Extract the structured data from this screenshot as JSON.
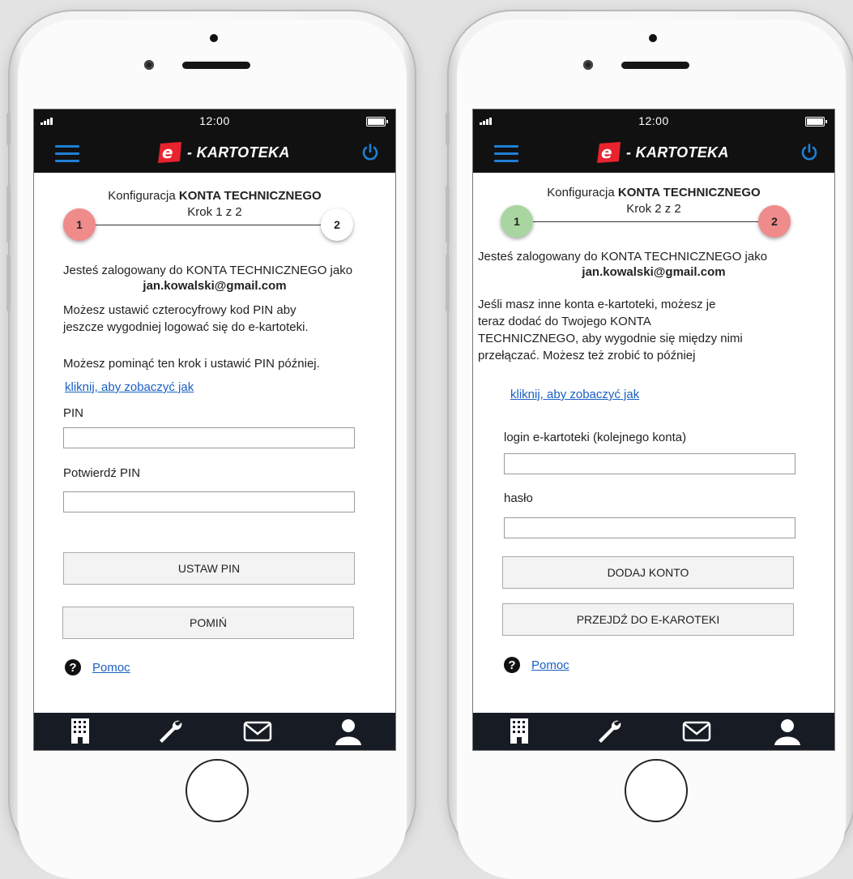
{
  "status_bar": {
    "time": "12:00"
  },
  "header": {
    "logo_text": "- KARTOTEKA",
    "logo_letter": "e"
  },
  "colors": {
    "accent": "#1e7fd6",
    "step_active": "#f08b8b",
    "step_done": "#a9d6a0",
    "link": "#1a5fc4",
    "nav_bg": "#161b24"
  },
  "icons": [
    "menu-icon",
    "power-icon",
    "building-icon",
    "wrench-icon",
    "mail-icon",
    "user-icon",
    "help-icon"
  ],
  "screen1": {
    "title_prefix": "Konfiguracja",
    "title_bold": "KONTA TECHNICZNEGO",
    "step": "Krok 1 z 2",
    "step1_label": "1",
    "step2_label": "2",
    "logged_in_text": "Jesteś zalogowany do KONTA TECHNICZNEGO  jako",
    "email": "jan.kowalski@gmail.com",
    "pin_info_line1": "Możesz ustawić czterocyfrowy kod PIN aby",
    "pin_info_line2": "jeszcze wygodniej logować się do e-kartoteki.",
    "skip_info": "Możesz pominąć ten krok i ustawić PIN później.",
    "link": "kliknij, aby zobaczyć jak",
    "pin_label": "PIN",
    "pin_value": "",
    "confirm_label": "Potwierdź PIN",
    "confirm_value": "",
    "set_pin_button": "USTAW PIN",
    "skip_button": "POMIŃ",
    "help_icon_glyph": "?",
    "help_link": "Pomoc"
  },
  "screen2": {
    "title_prefix": "Konfiguracja",
    "title_bold": "KONTA TECHNICZNEGO",
    "step": "Krok 2 z 2",
    "step1_label": "1",
    "step2_label": "2",
    "logged_in_text": "Jesteś zalogowany do KONTA TECHNICZNEGO  jako",
    "email": "jan.kowalski@gmail.com",
    "info_line1": "Jeśli masz inne konta e-kartoteki, możesz je",
    "info_line2": "teraz dodać do Twojego KONTA",
    "info_line3": "TECHNICZNEGO, aby wygodnie się między nimi",
    "info_line4": "przełączać. Możesz też zrobić to później",
    "link": "kliknij, aby zobaczyć jak",
    "login_label": "login e-kartoteki (kolejnego konta)",
    "login_value": "",
    "password_label": "hasło",
    "password_value": "",
    "add_account_button": "DODAJ KONTO",
    "go_button": "PRZEJDŹ DO E-KAROTEKI",
    "help_icon_glyph": "?",
    "help_link": "Pomoc"
  }
}
